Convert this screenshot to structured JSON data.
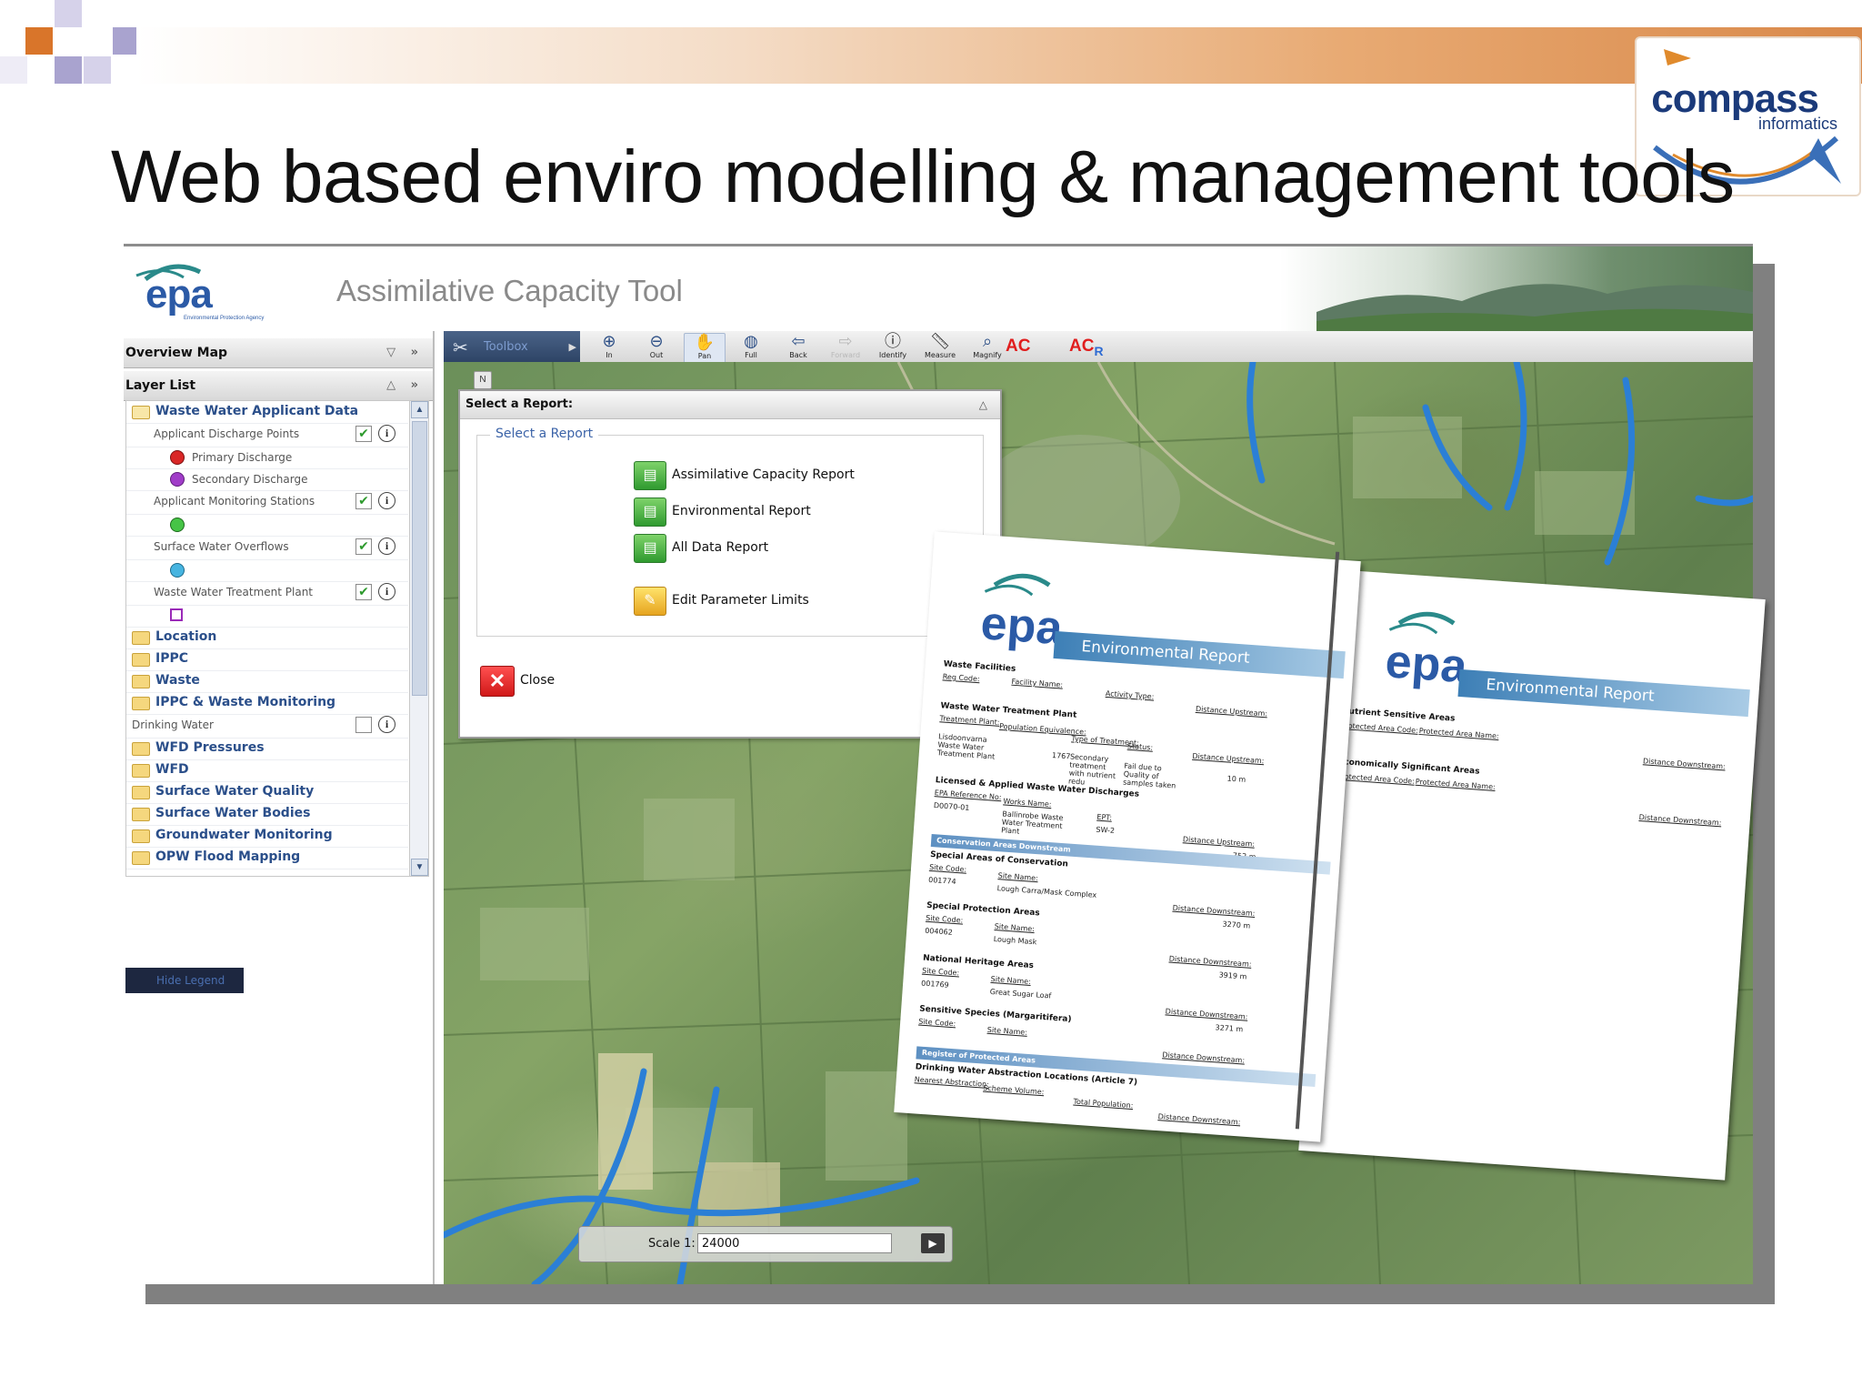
{
  "slide": {
    "title": "Web based enviro modelling & management tools",
    "logo_word": "compass",
    "logo_sub": "informatics"
  },
  "app": {
    "logo_text": "epa",
    "logo_sub": "Environmental Protection Agency",
    "title": "Assimilative Capacity Tool",
    "overview_map": "Overview Map",
    "layer_list_title": "Layer List",
    "hide_legend": "Hide Legend",
    "layers": [
      {
        "label": "Waste Water Applicant Data"
      },
      {
        "label": "Applicant Discharge Points"
      },
      {
        "label": "Primary Discharge"
      },
      {
        "label": "Secondary Discharge"
      },
      {
        "label": "Applicant Monitoring Stations"
      },
      {
        "label": "Surface Water Overflows"
      },
      {
        "label": "Waste Water Treatment Plant"
      },
      {
        "label": "Location"
      },
      {
        "label": "IPPC"
      },
      {
        "label": "Waste"
      },
      {
        "label": "IPPC & Waste Monitoring"
      },
      {
        "label": "Drinking Water"
      },
      {
        "label": "WFD Pressures"
      },
      {
        "label": "WFD"
      },
      {
        "label": "Surface Water Quality"
      },
      {
        "label": "Surface Water Bodies"
      },
      {
        "label": "Groundwater Monitoring"
      },
      {
        "label": "OPW Flood Mapping"
      }
    ],
    "toolbar": {
      "toolbox": "Toolbox",
      "tools": [
        "In",
        "Out",
        "Pan",
        "Full",
        "Back",
        "Forward",
        "Identify",
        "Measure",
        "Magnify"
      ],
      "ac": "AC",
      "acr_main": "AC",
      "acr_sub": "R"
    },
    "north": "N",
    "dialog": {
      "header": "Select a Report:",
      "group_label": "Select a Report",
      "items": [
        "Assimilative Capacity Report",
        "Environmental Report",
        "All Data Report",
        "Edit Parameter Limits"
      ],
      "close": "Close"
    },
    "scale": {
      "label": "Scale 1:",
      "value": "24000"
    }
  },
  "report_page_1": {
    "banner": "Environmental Report",
    "waste_facilities": "Waste Facilities",
    "reg_code": "Reg Code:",
    "facility_name": "Facility Name:",
    "activity_type": "Activity Type:",
    "distance_upstream": "Distance Upstream:",
    "wwtp_head": "Waste Water Treatment Plant",
    "treatment_plant": "Treatment Plant:",
    "population_equivalence": "Population Equivalence:",
    "type_of_treatment": "Type of Treatment:",
    "status": "Status:",
    "plant_name": "Lisdoonvarna Waste Water Treatment Plant",
    "pe_value": "1767",
    "treatment_value": "Secondary treatment with nutrient redu",
    "status_value": "Fail due to Quality of samples taken",
    "upstream_value": "10 m",
    "licensed_head": "Licensed & Applied Waste Water Discharges",
    "epa_ref": "EPA Reference No:",
    "works_name": "Works Name:",
    "ept": "EPT:",
    "ref_value": "D0070-01",
    "works_value": "Ballinrobe Waste Water Treatment Plant",
    "ept_value": "SW-2",
    "upstream_value_2": "752 m",
    "conservation_bar": "Conservation Areas Downstream",
    "sac_head": "Special Areas of Conservation",
    "site_code": "Site Code:",
    "site_name": "Site Name:",
    "distance_downstream": "Distance Downstream:",
    "sac_code": "001774",
    "sac_name": "Lough Carra/Mask Complex",
    "sac_dist": "3270 m",
    "spa_head": "Special Protection Areas",
    "spa_code": "004062",
    "spa_name": "Lough Mask",
    "spa_dist": "3919 m",
    "nha_head": "National Heritage Areas",
    "nha_code": "001769",
    "nha_name": "Great Sugar Loaf",
    "nha_dist": "3271 m",
    "species_head": "Sensitive Species (Margaritifera)",
    "register_bar": "Register of Protected Areas",
    "drinking_head": "Drinking Water Abstraction Locations (Article 7)",
    "nearest_abstraction": "Nearest Abstraction:",
    "scheme_volume": "Scheme Volume:",
    "total_population": "Total Population:"
  },
  "report_page_2": {
    "banner": "Environmental Report",
    "nutrient_head": "Nutrient Sensitive Areas",
    "protected_code": "Protected Area Code:",
    "protected_name": "Protected Area Name:",
    "distance_downstream": "Distance Downstream:",
    "economic_head": "Economically Significant Areas"
  },
  "colors": {
    "accent_orange": "#d9894a",
    "epa_teal": "#2a8a8a",
    "epa_blue": "#2b4f8a",
    "river_blue": "#2b7fd6",
    "close_red": "#d01818",
    "report_green": "#2f9a2f"
  }
}
